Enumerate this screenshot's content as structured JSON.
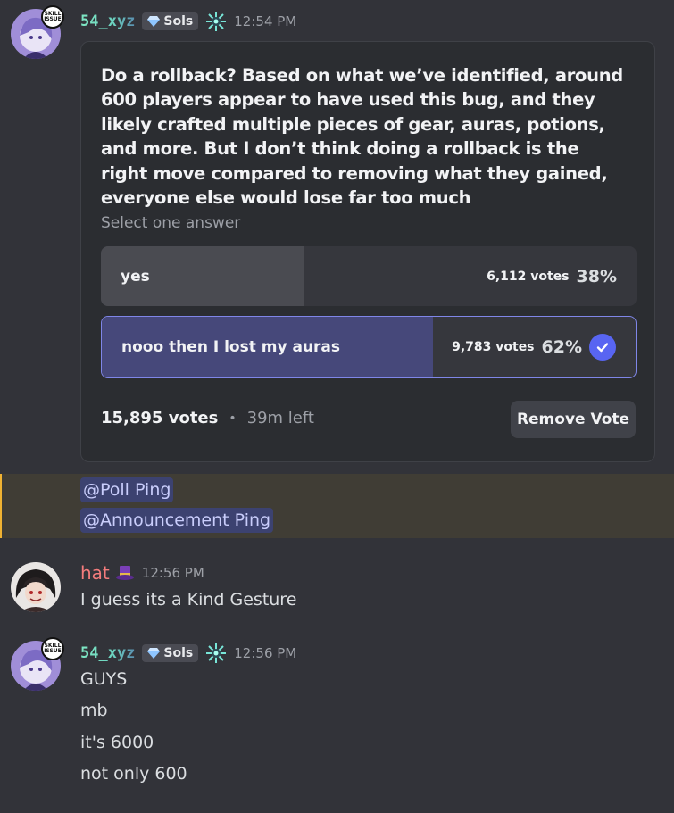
{
  "messages": [
    {
      "author": "54_xyz",
      "guild_tag": "Sols",
      "timestamp": "12:54 PM",
      "avatar_badge": "SKILL ISSUE",
      "poll": {
        "question": "Do a rollback? Based on what we’ve identified, around 600 players appear to have used this bug, and they likely crafted multiple pieces of gear, auras, potions, and more. But I don’t think doing a rollback is the right move compared to removing what they gained, everyone else would lose far too much",
        "hint": "Select one answer",
        "answers": [
          {
            "label": "yes",
            "votes": "6,112 votes",
            "percent": "38%",
            "fraction": 0.38,
            "selected": false
          },
          {
            "label": "nooo then I lost my auras",
            "votes": "9,783 votes",
            "percent": "62%",
            "fraction": 0.62,
            "selected": true
          }
        ],
        "total_votes": "15,895 votes",
        "separator": "•",
        "time_left": "39m left",
        "remove_vote_label": "Remove Vote"
      },
      "mentions": [
        "@Poll Ping",
        "@Announcement Ping"
      ]
    },
    {
      "author": "hat",
      "timestamp": "12:56 PM",
      "lines": [
        "I guess its a Kind Gesture"
      ]
    },
    {
      "author": "54_xyz",
      "guild_tag": "Sols",
      "timestamp": "12:56 PM",
      "avatar_badge": "SKILL ISSUE",
      "lines": [
        "GUYS",
        "mb",
        "it's 6000",
        "not only 600"
      ]
    }
  ],
  "colors": {
    "background": "#323339",
    "poll_card": "#2b2d31",
    "selected_border": "#7f86e8",
    "check_blue": "#5865f2",
    "mention_bg": "#3c4270",
    "highlight_band": "#403d35",
    "hat_name": "#f47c7c"
  }
}
